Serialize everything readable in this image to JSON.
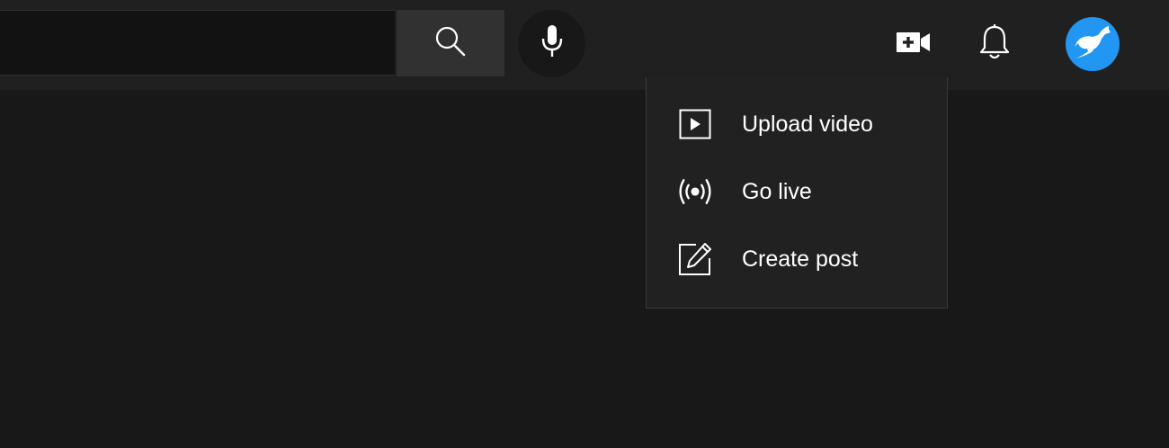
{
  "header": {
    "search": {
      "value": "",
      "placeholder": "",
      "button_icon": "search-icon"
    },
    "voice_search_icon": "microphone-icon",
    "create_icon": "video-camera-plus-icon",
    "notifications_icon": "bell-icon",
    "avatar": {
      "icon": "kangaroo-avatar",
      "color": "#2196f3"
    }
  },
  "create_menu": {
    "items": [
      {
        "label": "Upload video",
        "icon": "play-square-icon"
      },
      {
        "label": "Go live",
        "icon": "live-broadcast-icon"
      },
      {
        "label": "Create post",
        "icon": "edit-post-icon"
      }
    ]
  },
  "colors": {
    "background": "#181818",
    "header": "#202020",
    "menu": "#212121",
    "accent": "#2196f3",
    "text": "#ffffff"
  }
}
